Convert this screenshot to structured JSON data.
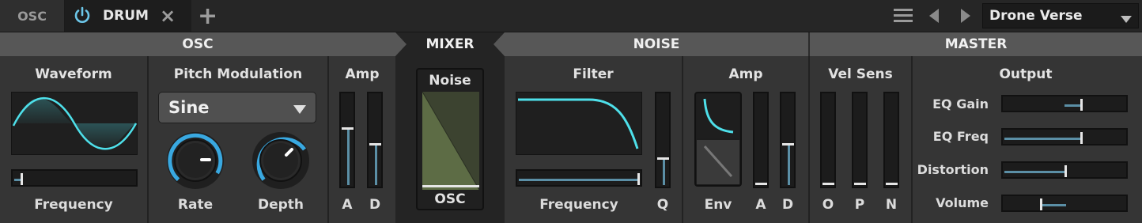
{
  "tabs": {
    "osc": "OSC",
    "drum": "DRUM",
    "close_icon": "×",
    "add_icon": "+"
  },
  "topbar": {
    "preset_name": "Drone Verse"
  },
  "sections": {
    "osc": "OSC",
    "mixer": "MIXER",
    "noise": "NOISE",
    "master": "MASTER"
  },
  "osc": {
    "waveform_title": "Waveform",
    "frequency_label": "Frequency",
    "frequency_value": 0.05,
    "pitch_mod_title": "Pitch Modulation",
    "pitch_mod_shape": "Sine",
    "rate_label": "Rate",
    "rate_value": 0.62,
    "depth_label": "Depth",
    "depth_value": 0.72,
    "amp_title": "Amp",
    "attack_label": "A",
    "attack_value": 0.65,
    "decay_label": "D",
    "decay_value": 0.46
  },
  "mixer": {
    "top_label": "Noise",
    "bottom_label": "OSC",
    "mix_value": 0.0
  },
  "noise": {
    "filter_title": "Filter",
    "frequency_label": "Frequency",
    "frequency_value": 1.0,
    "q_label": "Q",
    "q_value": 0.31,
    "amp_title": "Amp",
    "env_label": "Env",
    "attack_label": "A",
    "attack_value": 0.0,
    "decay_label": "D",
    "decay_value": 0.46
  },
  "master": {
    "vel_sens_title": "Vel Sens",
    "vel_o_label": "O",
    "vel_o_value": 0.0,
    "vel_p_label": "P",
    "vel_p_value": 0.0,
    "vel_n_label": "N",
    "vel_n_value": 0.0,
    "output_title": "Output",
    "eq_gain_label": "EQ Gain",
    "eq_gain_value": 0.64,
    "eq_freq_label": "EQ Freq",
    "eq_freq_value": 0.64,
    "distortion_label": "Distortion",
    "distortion_value": 0.5,
    "volume_label": "Volume",
    "volume_value": 0.28
  },
  "colors": {
    "accent": "#4ee0ea",
    "fader_fill": "#5b8fa6",
    "panel": "#353535",
    "header": "#575757"
  }
}
